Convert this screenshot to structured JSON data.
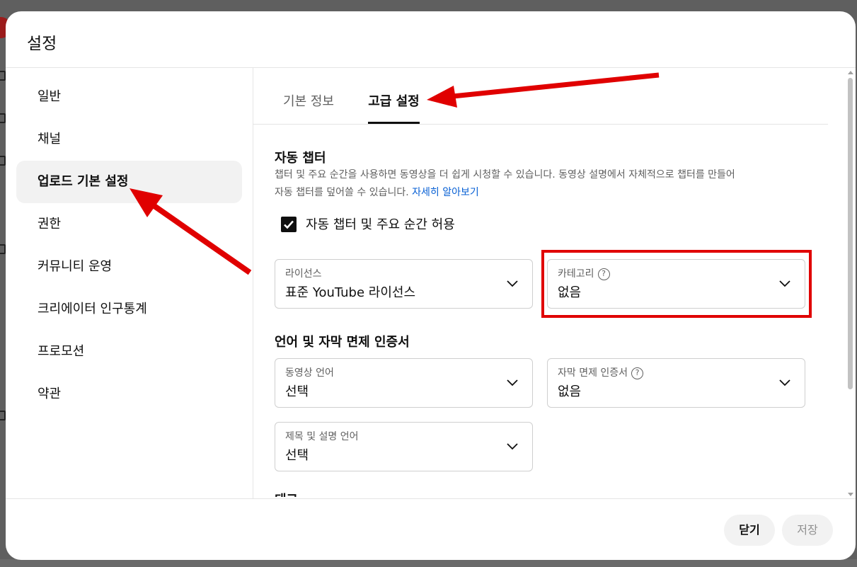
{
  "dialog": {
    "title": "설정"
  },
  "sidebar": {
    "items": [
      {
        "label": "일반"
      },
      {
        "label": "채널"
      },
      {
        "label": "업로드 기본 설정",
        "active": true
      },
      {
        "label": "권한"
      },
      {
        "label": "커뮤니티 운영"
      },
      {
        "label": "크리에이터 인구통계"
      },
      {
        "label": "프로모션"
      },
      {
        "label": "약관"
      }
    ]
  },
  "tabs": [
    {
      "label": "기본 정보"
    },
    {
      "label": "고급 설정",
      "active": true
    }
  ],
  "auto_chapters": {
    "title": "자동 챕터",
    "description_line1": "챕터 및 주요 순간을 사용하면 동영상을 더 쉽게 시청할 수 있습니다. 동영상 설명에서 자체적으로 챕터를 만들어",
    "description_line2": "자동 챕터를 덮어쓸 수 있습니다.",
    "learn_more": "자세히 알아보기",
    "checkbox_label": "자동 챕터 및 주요 순간 허용",
    "checkbox_checked": true
  },
  "license": {
    "label": "라이선스",
    "value": "표준 YouTube 라이선스"
  },
  "category": {
    "label": "카테고리",
    "value": "없음"
  },
  "language_section": {
    "title": "언어 및 자막 면제 인증서",
    "video_language": {
      "label": "동영상 언어",
      "value": "선택"
    },
    "caption_cert": {
      "label": "자막 면제 인증서",
      "value": "없음"
    },
    "title_desc_language": {
      "label": "제목 및 설명 언어",
      "value": "선택"
    }
  },
  "next_section": {
    "title": "태그"
  },
  "footer": {
    "close_label": "닫기",
    "save_label": "저장"
  },
  "icons": {
    "chevron": "chevron-down-icon",
    "help": "help-circle-icon",
    "check": "checkmark-icon"
  },
  "colors": {
    "link": "#065fd4",
    "annotation": "#e00000",
    "active_nav_bg": "#f2f2f2"
  }
}
